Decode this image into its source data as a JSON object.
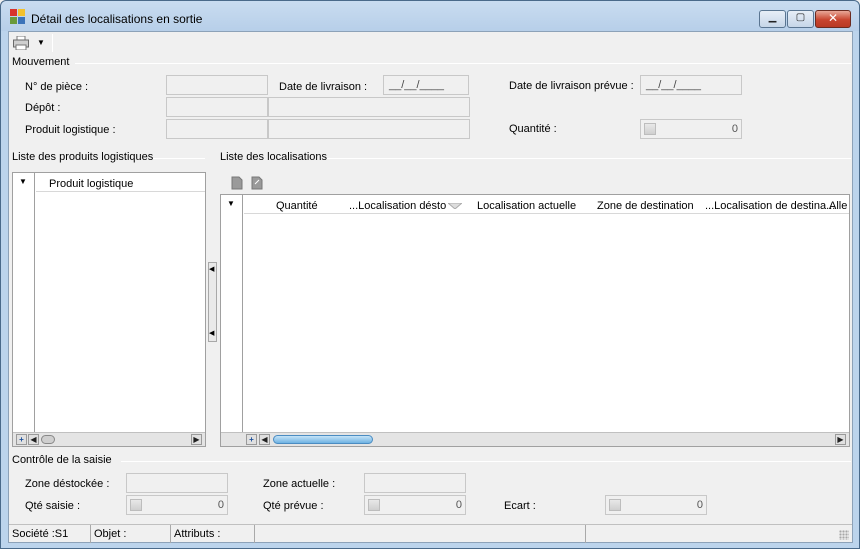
{
  "window": {
    "title": "Détail des localisations en sortie"
  },
  "titlebar_buttons": {
    "minimize": "▁",
    "maximize": "▢",
    "close": "✕"
  },
  "toolbar": {
    "print_dropdown": "▼"
  },
  "mouvement": {
    "group_label": "Mouvement",
    "piece_label": "N° de pièce :",
    "piece_value": "",
    "depot_label": "Dépôt :",
    "produit_label": "Produit logistique :",
    "date_livraison_label": "Date de livraison :",
    "date_livraison_value": "__/__/____",
    "date_prevue_label": "Date de livraison prévue :",
    "date_prevue_value": "__/__/____",
    "quantite_label": "Quantité :",
    "quantite_value": "0"
  },
  "produits": {
    "group_label": "Liste des produits logistiques",
    "column_header": "Produit logistique",
    "add_symbol": "+"
  },
  "localisations": {
    "group_label": "Liste des localisations",
    "columns": [
      "Quantité",
      "...Localisation désto",
      "Localisation actuelle",
      "Zone de destination",
      "...Localisation de destina...",
      "Alle"
    ],
    "add_symbol": "+"
  },
  "controle": {
    "group_label": "Contrôle de la saisie",
    "zone_destockee_label": "Zone déstockée :",
    "zone_actuelle_label": "Zone actuelle :",
    "qte_saisie_label": "Qté saisie :",
    "qte_saisie_value": "0",
    "qte_prevue_label": "Qté prévue :",
    "qte_prevue_value": "0",
    "ecart_label": "Ecart :",
    "ecart_value": "0"
  },
  "status": {
    "societe": "Société :S1",
    "objet": "Objet :",
    "attributs": "Attributs :"
  },
  "colors": {
    "accent_scroll": "#6fb2e2",
    "title_gradient": "#c9dcf0",
    "close_button": "#c8452f"
  }
}
